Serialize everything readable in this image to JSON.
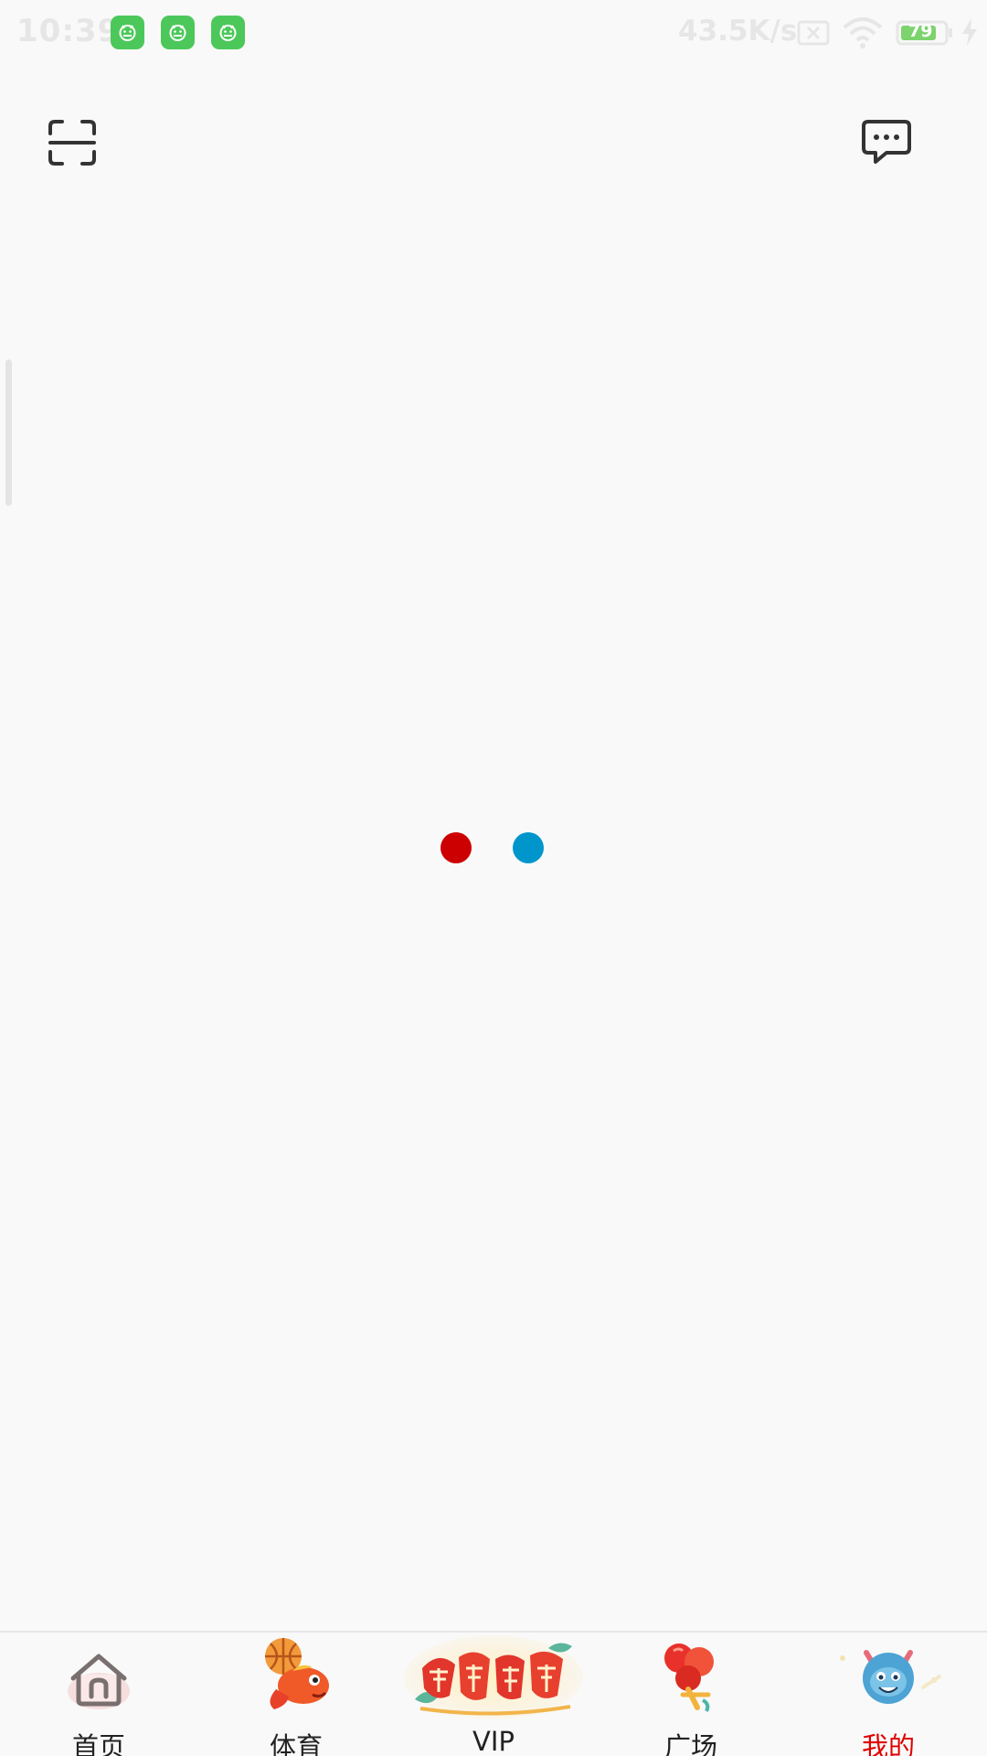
{
  "status_bar": {
    "time": "10:39",
    "network_speed": "43.5K/s",
    "battery_level": "79",
    "notification_icons": [
      "android-app-icon",
      "android-app-icon",
      "android-app-icon"
    ]
  },
  "header": {
    "scan_icon": "scan-icon",
    "message_icon": "message-icon"
  },
  "loading": {
    "colors": [
      "#cc0000",
      "#0096cc"
    ]
  },
  "nav": {
    "items": [
      {
        "label": "首页",
        "icon": "home-icon",
        "active": false
      },
      {
        "label": "体育",
        "icon": "sports-icon",
        "active": false
      },
      {
        "label": "VIP",
        "icon": "vip-banner",
        "active": false
      },
      {
        "label": "广场",
        "icon": "square-icon",
        "active": false
      },
      {
        "label": "我的",
        "icon": "profile-icon",
        "active": true
      }
    ],
    "active_color": "#e00000",
    "text_color": "#222222"
  }
}
